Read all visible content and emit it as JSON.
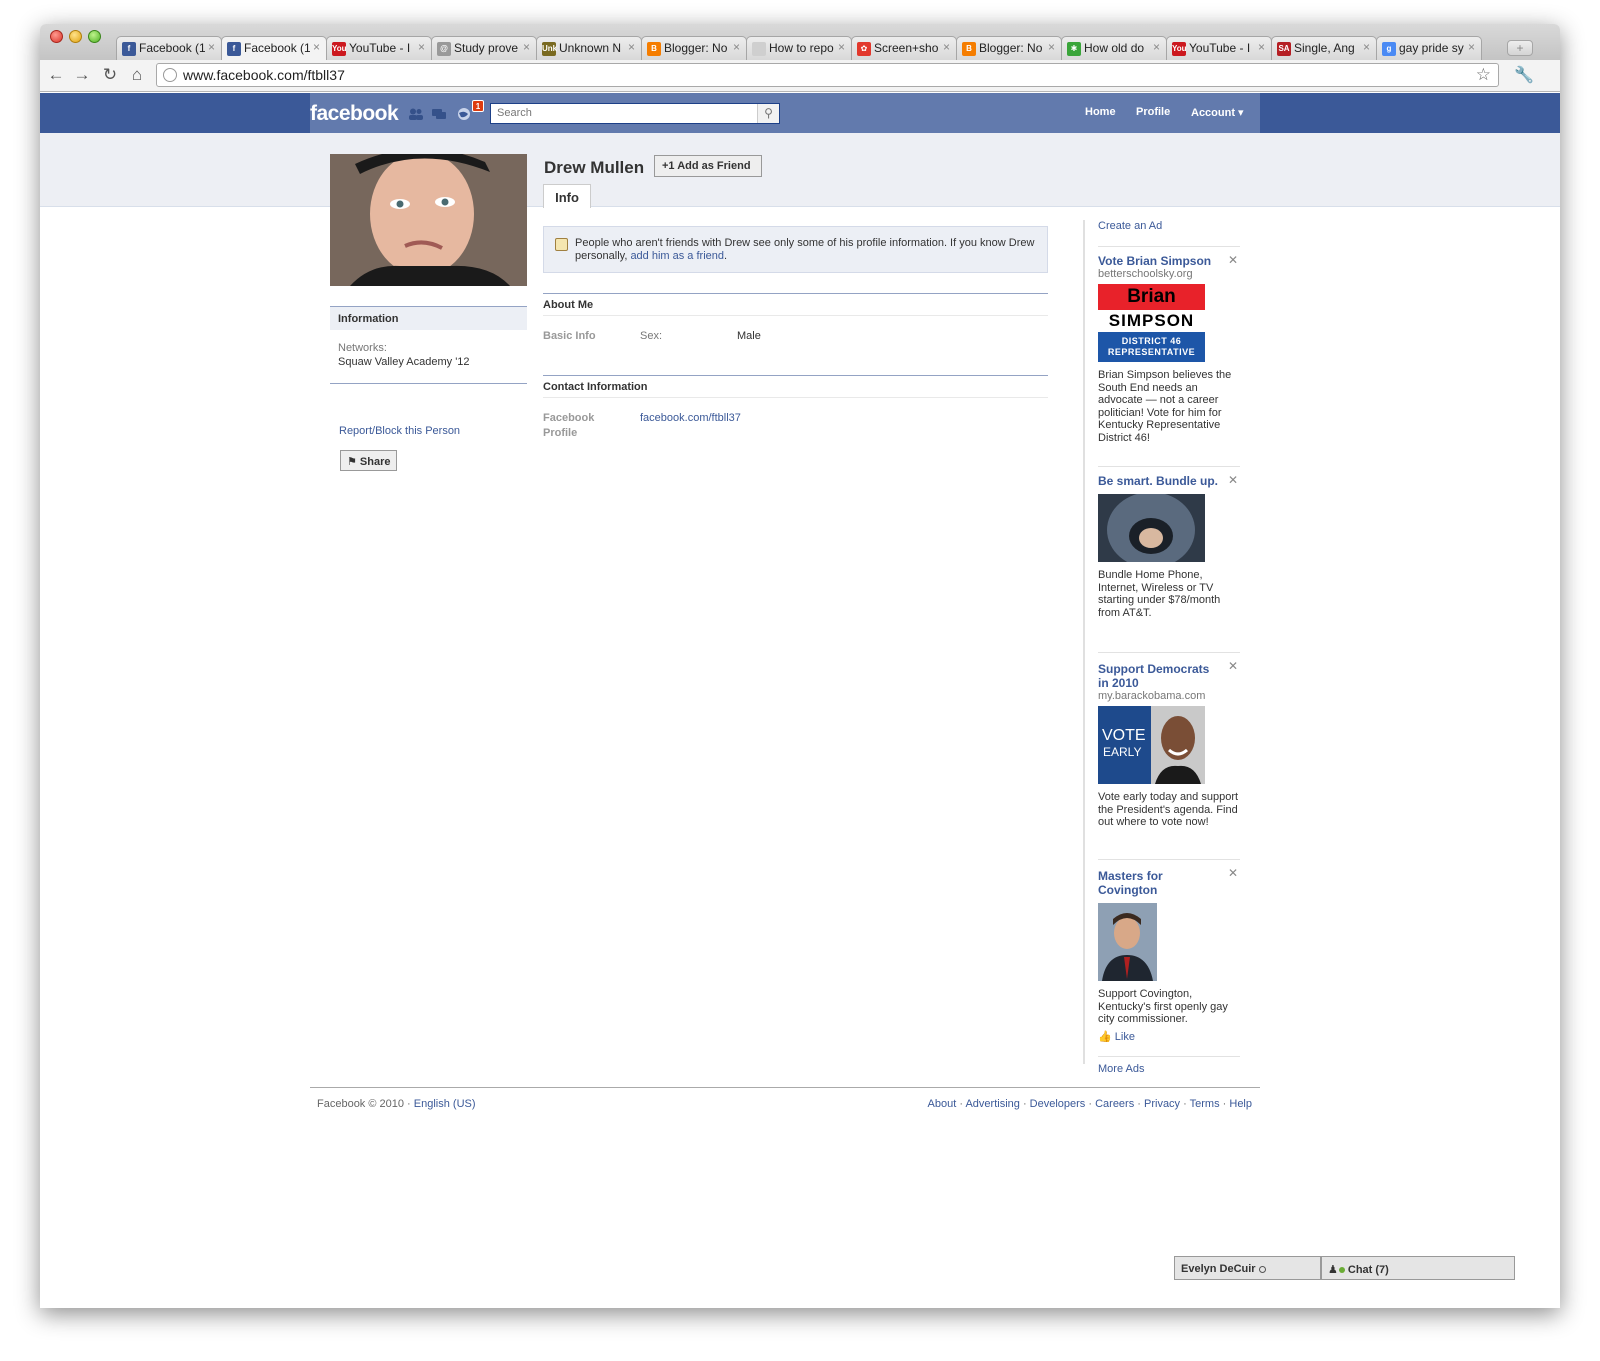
{
  "browser": {
    "tabs": [
      {
        "label": "Facebook (1",
        "icon": "facebook-favicon",
        "color": "#3b5998",
        "glyph": "f"
      },
      {
        "label": "Facebook (1",
        "icon": "facebook-favicon",
        "color": "#3b5998",
        "glyph": "f",
        "active": true
      },
      {
        "label": "YouTube - I",
        "icon": "youtube-favicon",
        "color": "#cc181e",
        "glyph": "You"
      },
      {
        "label": "Study prove",
        "icon": "loading-favicon",
        "color": "#999999",
        "glyph": "@"
      },
      {
        "label": "Unknown N",
        "icon": "unk-favicon",
        "color": "#7a6a20",
        "glyph": "Unk"
      },
      {
        "label": "Blogger: No",
        "icon": "blogger-favicon",
        "color": "#f57d00",
        "glyph": "B"
      },
      {
        "label": "How to repo",
        "icon": "page-favicon",
        "color": "#cfcfcf",
        "glyph": ""
      },
      {
        "label": "Screen+sho",
        "icon": "picasa-favicon",
        "color": "#e2382c",
        "glyph": "✿"
      },
      {
        "label": "Blogger: No",
        "icon": "blogger-favicon",
        "color": "#f57d00",
        "glyph": "B"
      },
      {
        "label": "How old do",
        "icon": "answers-favicon",
        "color": "#3aa53a",
        "glyph": "✱"
      },
      {
        "label": "YouTube - I",
        "icon": "youtube-favicon",
        "color": "#cc181e",
        "glyph": "You"
      },
      {
        "label": "Single, Ang",
        "icon": "sa-favicon",
        "color": "#b51f24",
        "glyph": "SA"
      },
      {
        "label": "gay pride sy",
        "icon": "google-favicon",
        "color": "#4a8af4",
        "glyph": "g"
      }
    ],
    "url": "www.facebook.com/ftbll37",
    "new_tab": "+"
  },
  "fb": {
    "logo": "facebook",
    "notification_count": "1",
    "search_placeholder": "Search",
    "nav": {
      "home": "Home",
      "profile": "Profile",
      "account": "Account ▾"
    }
  },
  "profile": {
    "name": "Drew Mullen",
    "add_friend": "+1 Add as Friend",
    "tab_info": "Info",
    "notice_text": "People who aren't friends with Drew see only some of his profile information. If you know Drew personally, ",
    "notice_link": "add him as a friend",
    "notice_end": ".",
    "about_head": "About Me",
    "basic_info_label": "Basic Info",
    "sex_label": "Sex:",
    "sex_value": "Male",
    "contact_head": "Contact Information",
    "fb_profile_label_1": "Facebook",
    "fb_profile_label_2": "Profile",
    "fb_profile_value": "facebook.com/ftbll37"
  },
  "left": {
    "info_head": "Information",
    "networks_label": "Networks:",
    "networks_value": "Squaw Valley Academy '12",
    "report": "Report/Block this Person",
    "share": "Share"
  },
  "ads": {
    "create_ad": "Create an Ad",
    "more_ads": "More Ads",
    "items": [
      {
        "title": "Vote Brian Simpson",
        "sub": "betterschoolsky.org",
        "img_line1": "Brian",
        "img_line2": "SIMPSON",
        "img_line3": "DISTRICT 46",
        "img_line4": "REPRESENTATIVE",
        "body": "Brian Simpson believes the South End needs an advocate — not a career politician! Vote for him for Kentucky Representative District 46!"
      },
      {
        "title": "Be smart. Bundle up.",
        "body": "Bundle Home Phone, Internet, Wireless or TV starting under $78/month from AT&T."
      },
      {
        "title": "Support Democrats in 2010",
        "sub": "my.barackobama.com",
        "img_line1": "VOTE",
        "img_line2": "EARLY",
        "body": "Vote early today and support the President's agenda. Find out where to vote now!"
      },
      {
        "title": "Masters for Covington",
        "body": "Support Covington, Kentucky's first openly gay city commissioner.",
        "like": "Like"
      }
    ]
  },
  "footer": {
    "copyright": "Facebook © 2010 · ",
    "language": "English (US)",
    "links": [
      "About",
      "Advertising",
      "Developers",
      "Careers",
      "Privacy",
      "Terms",
      "Help"
    ]
  },
  "chat": {
    "user": "Evelyn DeCuir",
    "chat_label": "Chat (7)"
  }
}
